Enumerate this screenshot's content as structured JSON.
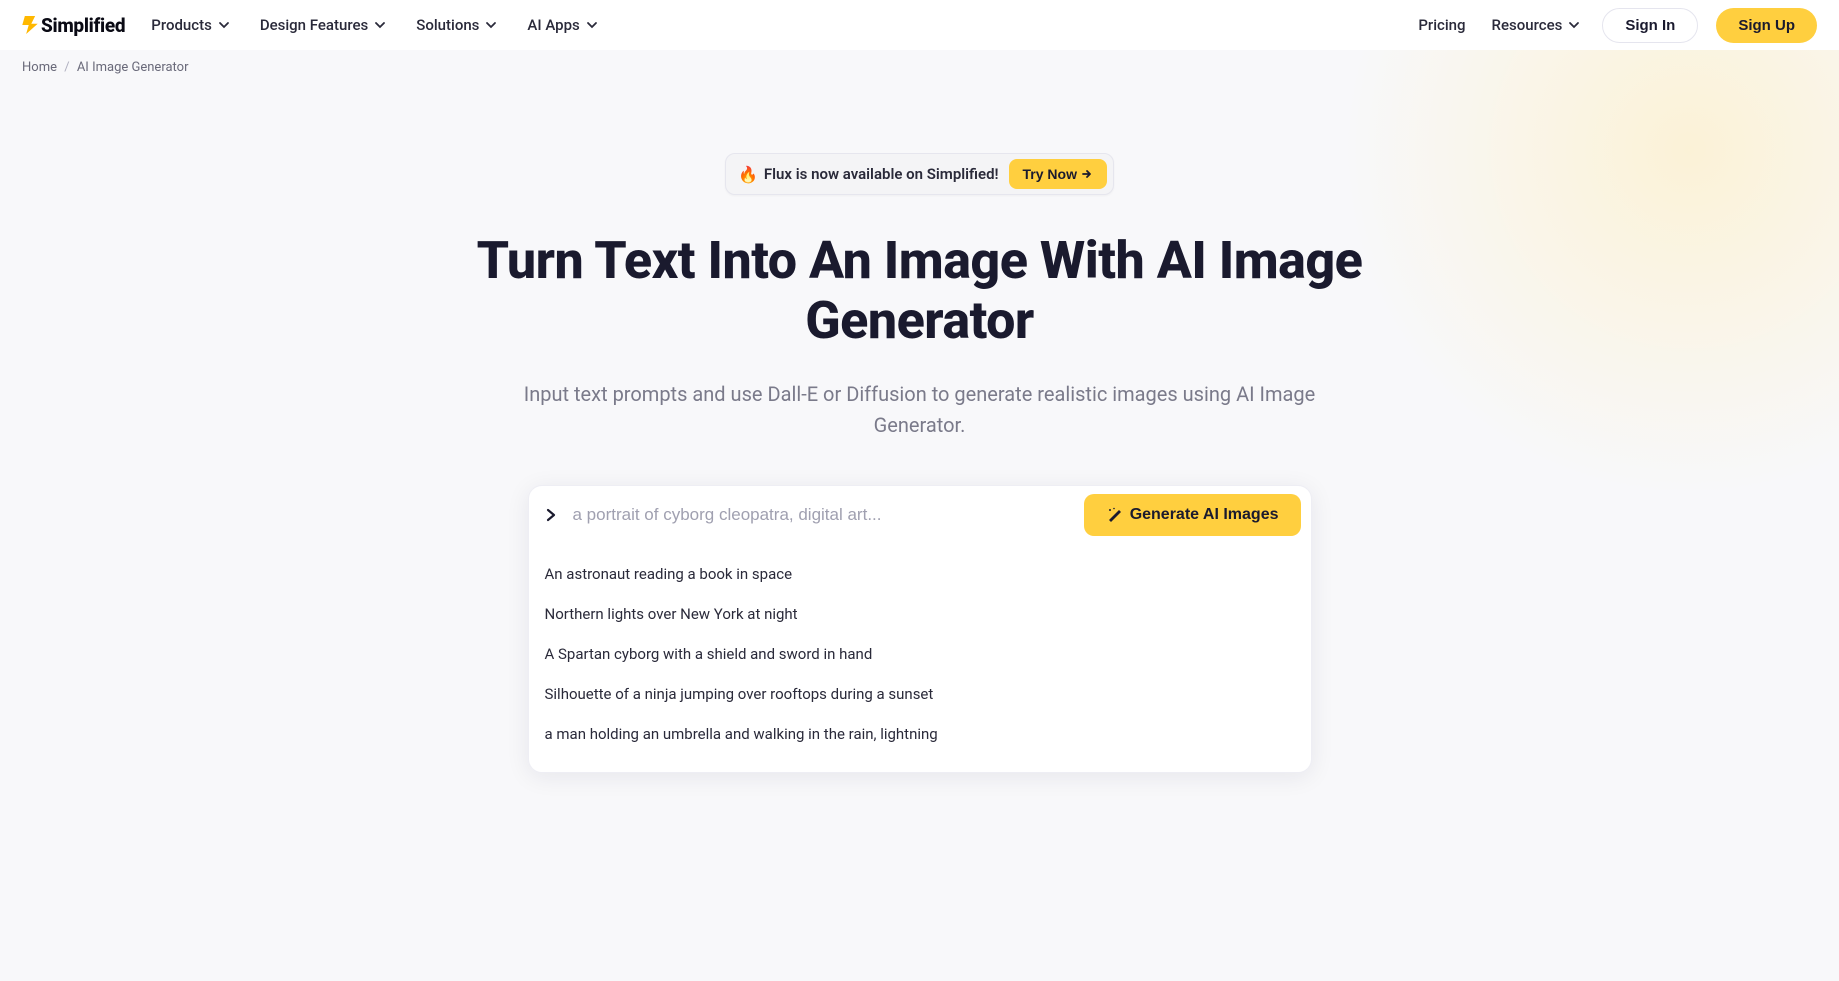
{
  "logo": {
    "text": "Simplified"
  },
  "nav": {
    "items": [
      {
        "label": "Products"
      },
      {
        "label": "Design Features"
      },
      {
        "label": "Solutions"
      },
      {
        "label": "AI Apps"
      }
    ],
    "pricing": "Pricing",
    "resources": "Resources",
    "sign_in": "Sign In",
    "sign_up": "Sign Up"
  },
  "breadcrumb": {
    "home": "Home",
    "current": "AI Image Generator"
  },
  "announcement": {
    "emoji": "🔥",
    "text": "Flux is now available on Simplified!",
    "cta": "Try Now"
  },
  "headline": "Turn Text Into An Image With AI Image Generator",
  "subhead": "Input text prompts and use Dall-E or Diffusion to generate realistic images using AI Image Generator.",
  "prompt": {
    "placeholder": "a portrait of cyborg cleopatra, digital art...",
    "generate_label": "Generate AI Images",
    "suggestions": [
      "An astronaut reading a book in space",
      "Northern lights over New York at night",
      "A Spartan cyborg with a shield and sword in hand",
      "Silhouette of a ninja jumping over rooftops during a sunset",
      "a man holding an umbrella and walking in the rain, lightning"
    ]
  }
}
